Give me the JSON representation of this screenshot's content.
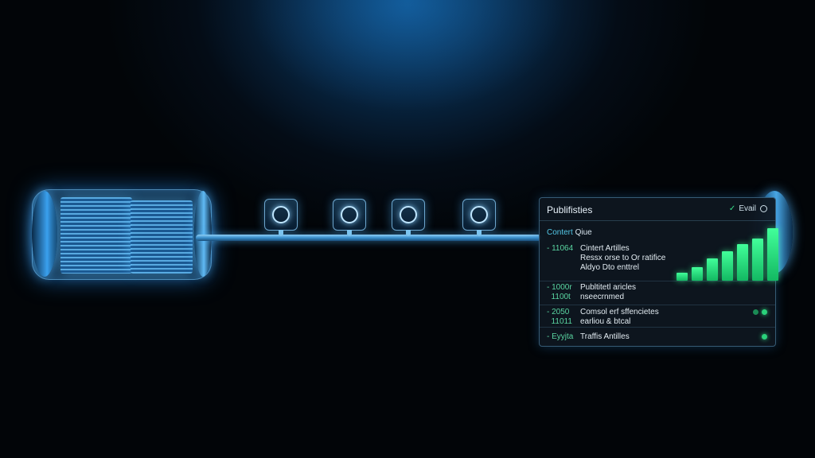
{
  "panel": {
    "title": "Publifisties",
    "status_label": "Evail",
    "section_label_prefix": "Contert",
    "section_label_suffix": "Qiue",
    "rows": [
      {
        "code": "- 11064",
        "lines": [
          "Cintert Artilles",
          "Ressx orse to Or ratifice",
          "Aldyo Dto enttrel"
        ]
      },
      {
        "code": "- 1000r\n  1100t",
        "lines": [
          "Publtitetl aricles",
          "nseecrnmed"
        ]
      },
      {
        "code": "- 2050\n  11011",
        "lines": [
          "Comsol erf sffencietes",
          "earliou & btcal"
        ]
      },
      {
        "code": "- Eyyjta",
        "lines": [
          "Traffis Antilles"
        ]
      }
    ]
  },
  "bar_chart": {
    "values": [
      12,
      20,
      34,
      45,
      56,
      64,
      80
    ],
    "color": "#2ee884"
  },
  "colors": {
    "accent_blue": "#3aa0ee",
    "accent_green": "#2ad17a",
    "background": "#040c16"
  },
  "icons": [
    "check-icon",
    "ring-icon",
    "status-dot",
    "pipeline-node-ring"
  ]
}
